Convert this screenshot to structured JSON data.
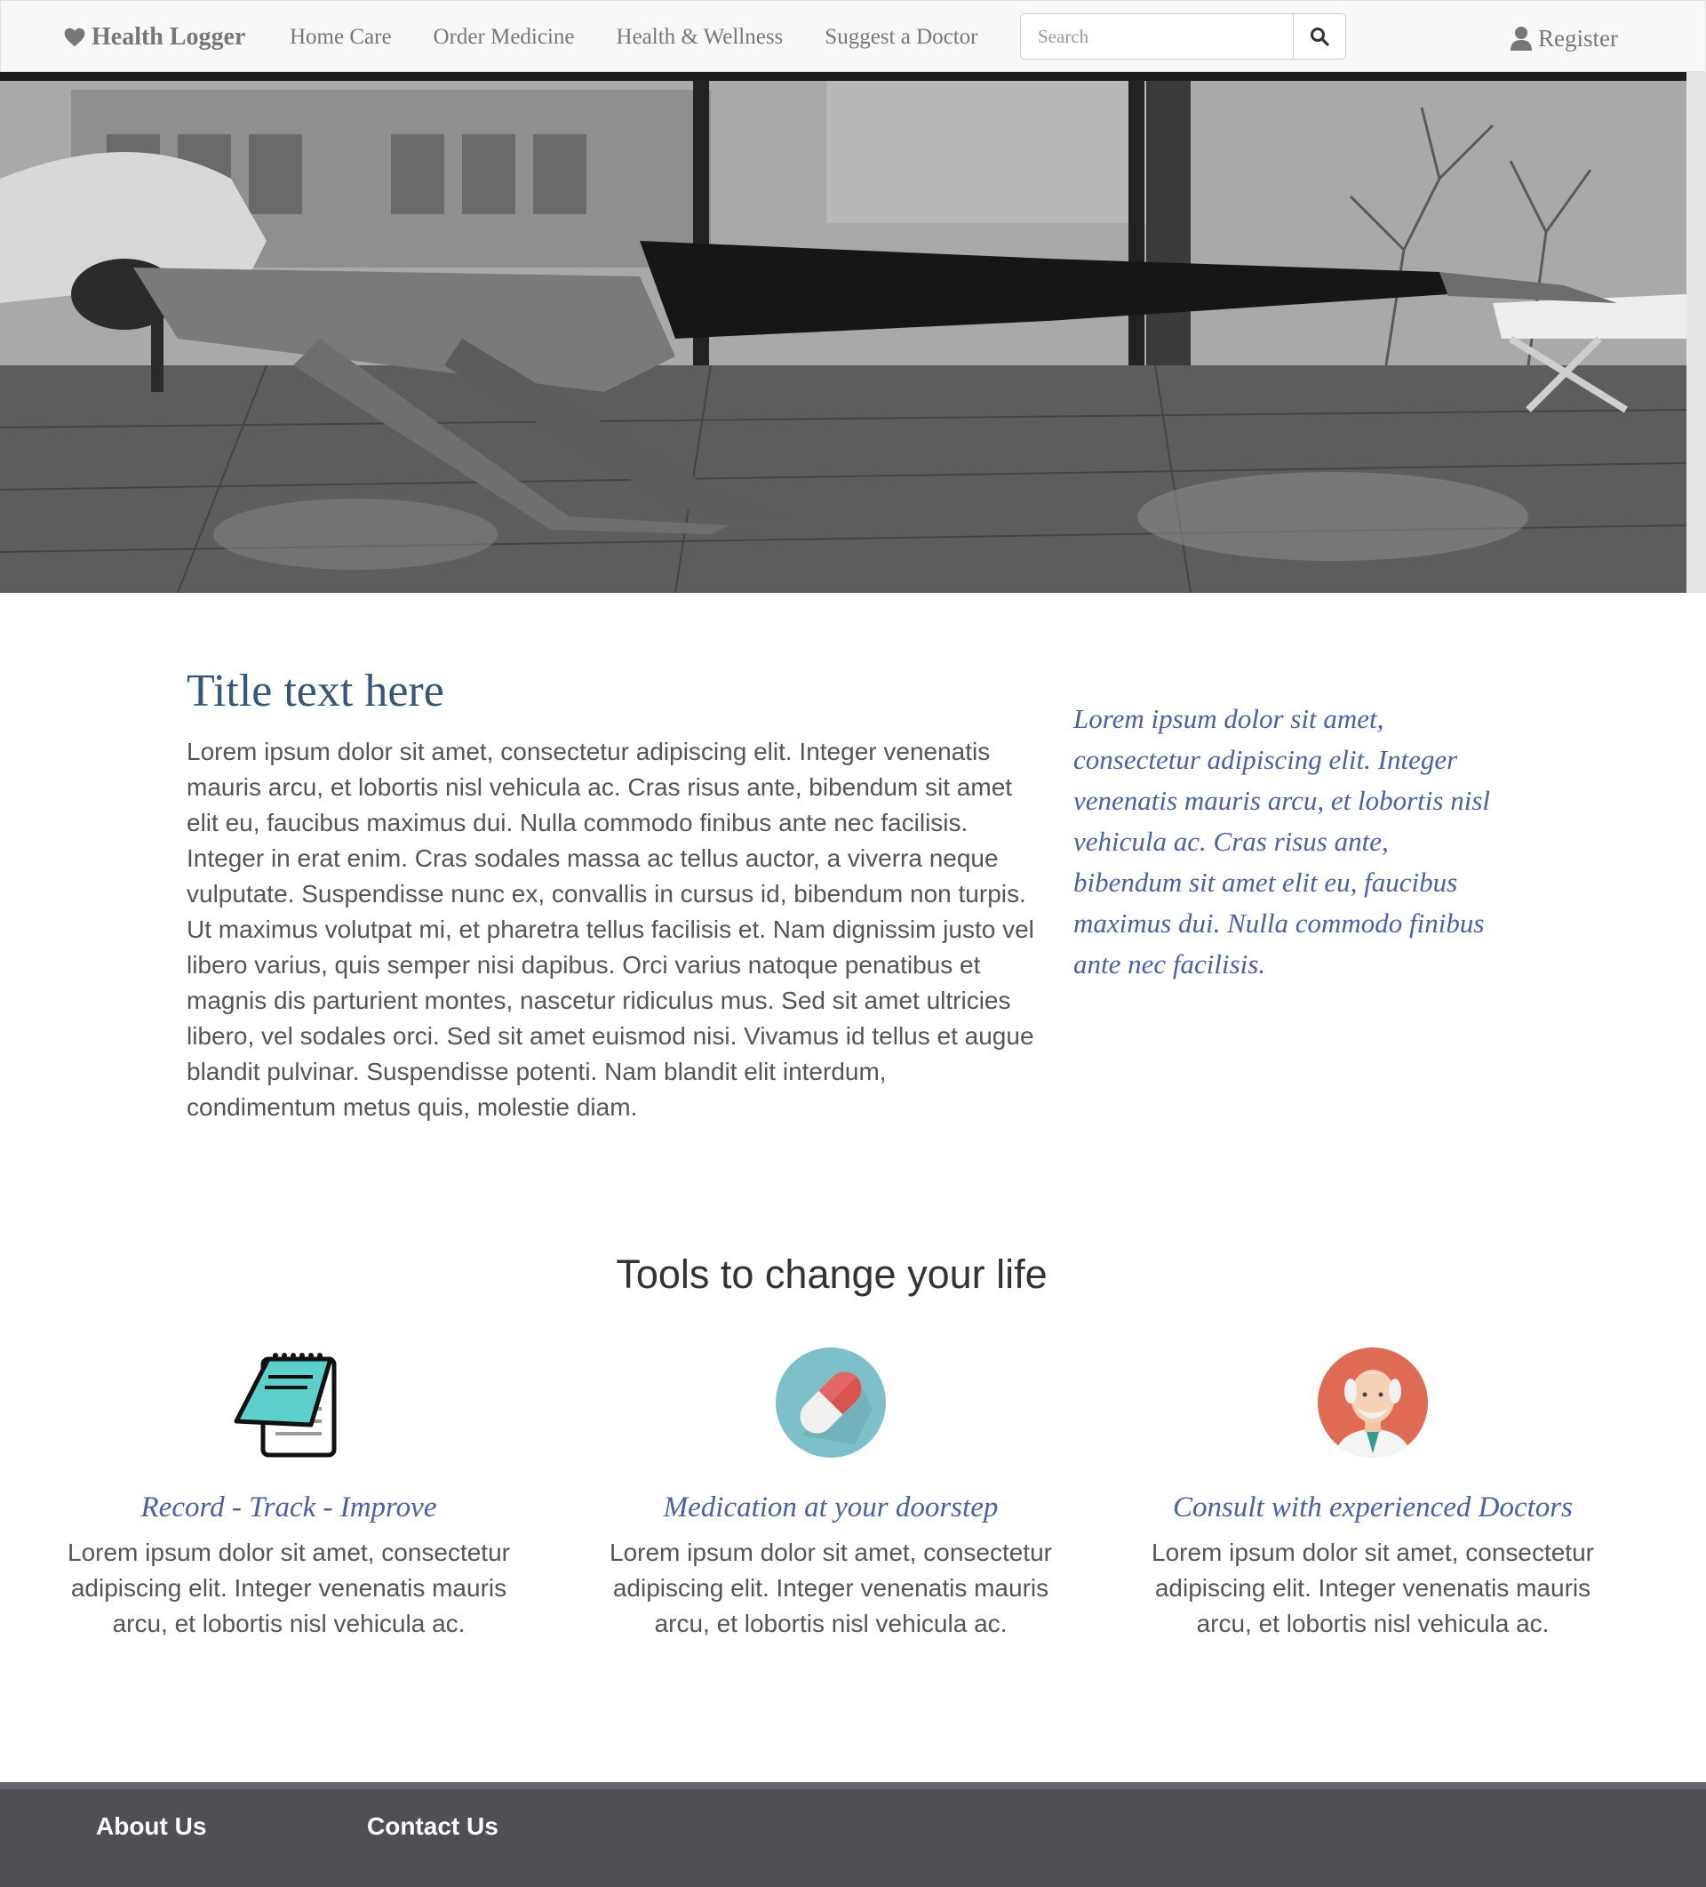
{
  "navbar": {
    "brand": "Health Logger",
    "links": [
      "Home Care",
      "Order Medicine",
      "Health & Wellness",
      "Suggest a Doctor"
    ],
    "search_placeholder": "Search",
    "register": "Register"
  },
  "intro": {
    "title": "Title text here",
    "body": "Lorem ipsum dolor sit amet, consectetur adipiscing elit. Integer venenatis mauris arcu, et lobortis nisl vehicula ac. Cras risus ante, bibendum sit amet elit eu, faucibus maximus dui. Nulla commodo finibus ante nec facilisis. Integer in erat enim. Cras sodales massa ac tellus auctor, a viverra neque vulputate. Suspendisse nunc ex, convallis in cursus id, bibendum non turpis. Ut maximus volutpat mi, et pharetra tellus facilisis et. Nam dignissim justo vel libero varius, quis semper nisi dapibus. Orci varius natoque penatibus et magnis dis parturient montes, nascetur ridiculus mus. Sed sit amet ultricies libero, vel sodales orci. Sed sit amet euismod nisi. Vivamus id tellus et augue blandit pulvinar. Suspendisse potenti. Nam blandit elit interdum, condimentum metus quis, molestie diam.",
    "quote": "Lorem ipsum dolor sit amet, consectetur adipiscing elit. Integer venenatis mauris arcu, et lobortis nisl vehicula ac. Cras risus ante, bibendum sit amet elit eu, faucibus maximus dui. Nulla commodo finibus ante nec facilisis."
  },
  "tools": {
    "heading": "Tools to change your life",
    "items": [
      {
        "icon": "notepad-icon",
        "title": "Record - Track - Improve",
        "text": "Lorem ipsum dolor sit amet, consectetur adipiscing elit. Integer venenatis mauris arcu, et lobortis nisl vehicula ac."
      },
      {
        "icon": "pill-icon",
        "title": "Medication at your doorstep",
        "text": "Lorem ipsum dolor sit amet, consectetur adipiscing elit. Integer venenatis mauris arcu, et lobortis nisl vehicula ac."
      },
      {
        "icon": "doctor-icon",
        "title": "Consult with experienced Doctors",
        "text": "Lorem ipsum dolor sit amet, consectetur adipiscing elit. Integer venenatis mauris arcu, et lobortis nisl vehicula ac."
      }
    ]
  },
  "footer": {
    "about": "About Us",
    "contact": "Contact Us"
  },
  "colors": {
    "navbar_bg": "#f8f8f8",
    "title_blue": "#34577a",
    "accent_italic": "#4b5fa8",
    "footer_bg": "#4f4f56"
  }
}
